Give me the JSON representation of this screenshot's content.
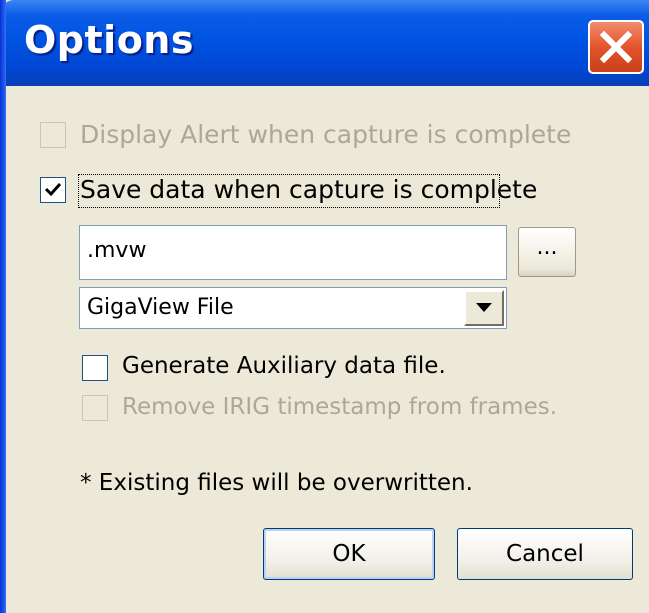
{
  "window": {
    "title": "Options"
  },
  "options": {
    "display_alert_label": "Display Alert when capture is complete",
    "display_alert_checked": false,
    "save_data_label": "Save data when capture is complete",
    "save_data_checked": true
  },
  "file": {
    "extension_value": ".mvw",
    "browse_label": "...",
    "format_selected": "GigaView File"
  },
  "sub_options": {
    "aux_file_label": "Generate Auxiliary data file.",
    "aux_file_checked": false,
    "remove_irig_label": "Remove IRIG timestamp from frames.",
    "remove_irig_checked": false
  },
  "note": "* Existing files will be overwritten.",
  "buttons": {
    "ok": "OK",
    "cancel": "Cancel"
  },
  "colors": {
    "titlebar": "#0054e3",
    "close_button": "#e3542b",
    "dialog_bg": "#ece9d8",
    "disabled_text": "#aca899"
  },
  "icons": {
    "close": "close-icon",
    "checkmark": "checkmark-icon",
    "dropdown": "chevron-down-icon"
  }
}
